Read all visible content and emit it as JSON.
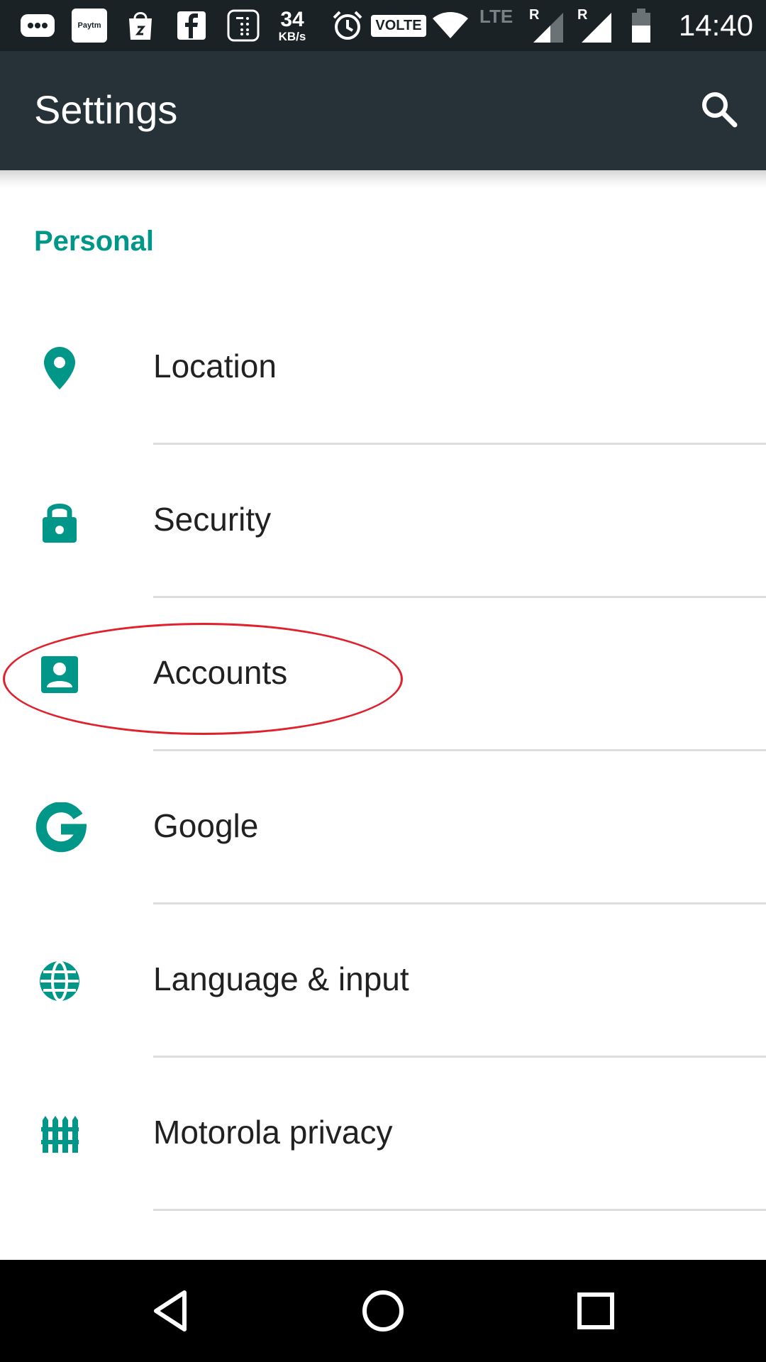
{
  "status_bar": {
    "network_speed_value": "34",
    "network_speed_unit": "KB/s",
    "volte_label": "VOLTE",
    "lte_label": "LTE",
    "roaming_label_1": "R",
    "roaming_label_2": "R",
    "paytm_label": "Paytm",
    "time": "14:40"
  },
  "app_bar": {
    "title": "Settings",
    "search_icon": "search-icon"
  },
  "section": {
    "header": "Personal"
  },
  "items": [
    {
      "label": "Location",
      "icon": "location-pin-icon"
    },
    {
      "label": "Security",
      "icon": "lock-icon"
    },
    {
      "label": "Accounts",
      "icon": "account-box-icon"
    },
    {
      "label": "Google",
      "icon": "google-g-icon"
    },
    {
      "label": "Language & input",
      "icon": "globe-icon"
    },
    {
      "label": "Motorola privacy",
      "icon": "fence-icon"
    }
  ],
  "nav_bar": {
    "back_icon": "back-triangle-icon",
    "home_icon": "home-circle-icon",
    "recents_icon": "recents-square-icon"
  },
  "colors": {
    "accent": "#009688",
    "app_bar": "#263238",
    "status_bar": "#1b2226",
    "annotation": "#e0212b"
  }
}
